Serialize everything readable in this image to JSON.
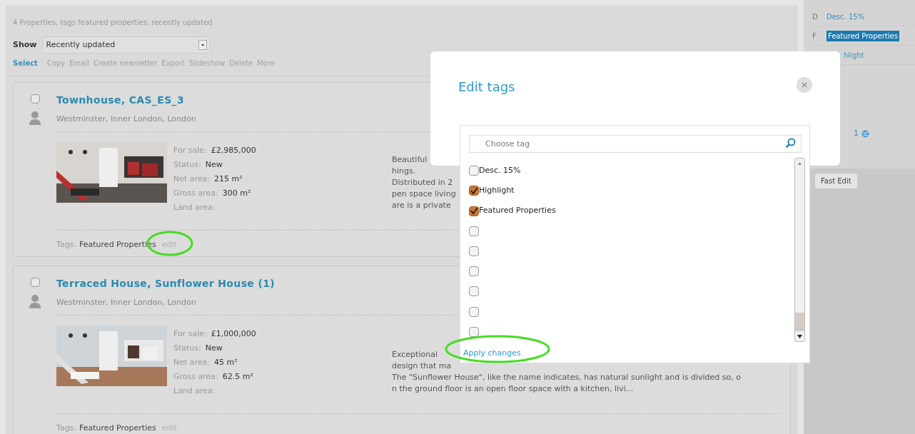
{
  "summary": "4 Properties, tags featured properties, recently updated",
  "show": {
    "label": "Show",
    "value": "Recently updated"
  },
  "actions": {
    "select": "Select",
    "items": [
      "Copy",
      "Email",
      "Create newsletter",
      "Export",
      "Slideshow",
      "Delete",
      "More"
    ]
  },
  "properties": [
    {
      "title": "Townhouse, CAS_ES_3",
      "location": "Westminster, Inner London, London",
      "checked": false,
      "image": {
        "kind": "picture"
      },
      "details": [
        {
          "label": "For sale:",
          "value": "£2,985,000"
        },
        {
          "label": "Status:",
          "value": "New"
        },
        {
          "label": "Net area:",
          "value": "215 m²"
        },
        {
          "label": "Gross area:",
          "value": "300 m²"
        },
        {
          "label": "Land area:"
        }
      ],
      "description": [
        "Beautiful",
        "hings.",
        "Distributed in 2",
        "pen space living",
        "are is a private"
      ],
      "tags_label": "Tags:",
      "tags": "Featured Properties",
      "edit": "edit",
      "circled": true
    },
    {
      "title": "Terraced House, Sunflower House (1)",
      "location": "Westminster, Inner London, London",
      "checked": false,
      "image": {
        "kind": "picture"
      },
      "details": [
        {
          "label": "For sale:",
          "value": "£1,000,000"
        },
        {
          "label": "Status:",
          "value": "New"
        },
        {
          "label": "Net area:",
          "value": "45 m²"
        },
        {
          "label": "Gross area:",
          "value": "62.5 m²"
        },
        {
          "label": "Land area:"
        }
      ],
      "description": [
        "Exceptional",
        "design that ma",
        "The \"Sunflower House\", like the name indicates, has natural sunlight and is divided so, o",
        "n the ground floor is an open floor space with a kitchen, livi..."
      ],
      "tags_label": "Tags:",
      "tags": "Featured Properties",
      "edit": "edit",
      "circled": false
    }
  ],
  "sidebar": {
    "tags": [
      {
        "letter": "D",
        "name": "Desc. 15%",
        "selected": false
      },
      {
        "letter": "F",
        "name": "Featured Properties",
        "selected": true
      },
      {
        "name": "hlight",
        "selected": false
      }
    ],
    "count": "1",
    "fast_edit": "Fast Edit"
  },
  "modal": {
    "title": "Edit tags",
    "search": {
      "placeholder": "Choose tag"
    },
    "tags": [
      {
        "label": "Desc. 15%",
        "checked": false
      },
      {
        "label": "Highlight",
        "checked": true
      },
      {
        "label": "Featured Properties",
        "checked": true
      },
      {
        "checked": false
      },
      {
        "checked": false
      },
      {
        "checked": false
      },
      {
        "checked": false
      },
      {
        "checked": false
      },
      {
        "checked": false
      }
    ],
    "apply": "Apply changes",
    "apply_circled": true
  }
}
